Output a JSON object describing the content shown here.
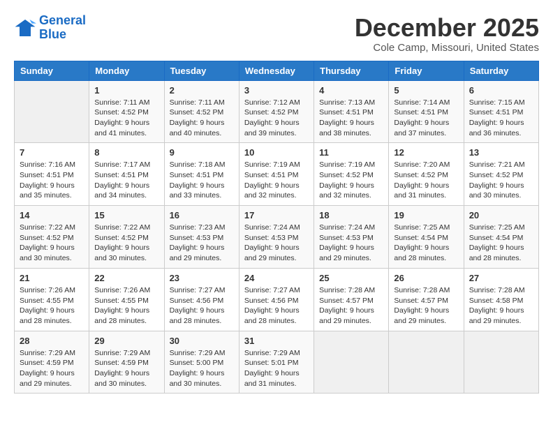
{
  "header": {
    "logo": {
      "line1": "General",
      "line2": "Blue"
    },
    "title": "December 2025",
    "subtitle": "Cole Camp, Missouri, United States"
  },
  "weekdays": [
    "Sunday",
    "Monday",
    "Tuesday",
    "Wednesday",
    "Thursday",
    "Friday",
    "Saturday"
  ],
  "weeks": [
    [
      {
        "day": "",
        "empty": true
      },
      {
        "day": "1",
        "sunrise": "7:11 AM",
        "sunset": "4:52 PM",
        "daylight": "9 hours and 41 minutes."
      },
      {
        "day": "2",
        "sunrise": "7:11 AM",
        "sunset": "4:52 PM",
        "daylight": "9 hours and 40 minutes."
      },
      {
        "day": "3",
        "sunrise": "7:12 AM",
        "sunset": "4:52 PM",
        "daylight": "9 hours and 39 minutes."
      },
      {
        "day": "4",
        "sunrise": "7:13 AM",
        "sunset": "4:51 PM",
        "daylight": "9 hours and 38 minutes."
      },
      {
        "day": "5",
        "sunrise": "7:14 AM",
        "sunset": "4:51 PM",
        "daylight": "9 hours and 37 minutes."
      },
      {
        "day": "6",
        "sunrise": "7:15 AM",
        "sunset": "4:51 PM",
        "daylight": "9 hours and 36 minutes."
      }
    ],
    [
      {
        "day": "7",
        "sunrise": "7:16 AM",
        "sunset": "4:51 PM",
        "daylight": "9 hours and 35 minutes."
      },
      {
        "day": "8",
        "sunrise": "7:17 AM",
        "sunset": "4:51 PM",
        "daylight": "9 hours and 34 minutes."
      },
      {
        "day": "9",
        "sunrise": "7:18 AM",
        "sunset": "4:51 PM",
        "daylight": "9 hours and 33 minutes."
      },
      {
        "day": "10",
        "sunrise": "7:19 AM",
        "sunset": "4:51 PM",
        "daylight": "9 hours and 32 minutes."
      },
      {
        "day": "11",
        "sunrise": "7:19 AM",
        "sunset": "4:52 PM",
        "daylight": "9 hours and 32 minutes."
      },
      {
        "day": "12",
        "sunrise": "7:20 AM",
        "sunset": "4:52 PM",
        "daylight": "9 hours and 31 minutes."
      },
      {
        "day": "13",
        "sunrise": "7:21 AM",
        "sunset": "4:52 PM",
        "daylight": "9 hours and 30 minutes."
      }
    ],
    [
      {
        "day": "14",
        "sunrise": "7:22 AM",
        "sunset": "4:52 PM",
        "daylight": "9 hours and 30 minutes."
      },
      {
        "day": "15",
        "sunrise": "7:22 AM",
        "sunset": "4:52 PM",
        "daylight": "9 hours and 30 minutes."
      },
      {
        "day": "16",
        "sunrise": "7:23 AM",
        "sunset": "4:53 PM",
        "daylight": "9 hours and 29 minutes."
      },
      {
        "day": "17",
        "sunrise": "7:24 AM",
        "sunset": "4:53 PM",
        "daylight": "9 hours and 29 minutes."
      },
      {
        "day": "18",
        "sunrise": "7:24 AM",
        "sunset": "4:53 PM",
        "daylight": "9 hours and 29 minutes."
      },
      {
        "day": "19",
        "sunrise": "7:25 AM",
        "sunset": "4:54 PM",
        "daylight": "9 hours and 28 minutes."
      },
      {
        "day": "20",
        "sunrise": "7:25 AM",
        "sunset": "4:54 PM",
        "daylight": "9 hours and 28 minutes."
      }
    ],
    [
      {
        "day": "21",
        "sunrise": "7:26 AM",
        "sunset": "4:55 PM",
        "daylight": "9 hours and 28 minutes."
      },
      {
        "day": "22",
        "sunrise": "7:26 AM",
        "sunset": "4:55 PM",
        "daylight": "9 hours and 28 minutes."
      },
      {
        "day": "23",
        "sunrise": "7:27 AM",
        "sunset": "4:56 PM",
        "daylight": "9 hours and 28 minutes."
      },
      {
        "day": "24",
        "sunrise": "7:27 AM",
        "sunset": "4:56 PM",
        "daylight": "9 hours and 28 minutes."
      },
      {
        "day": "25",
        "sunrise": "7:28 AM",
        "sunset": "4:57 PM",
        "daylight": "9 hours and 29 minutes."
      },
      {
        "day": "26",
        "sunrise": "7:28 AM",
        "sunset": "4:57 PM",
        "daylight": "9 hours and 29 minutes."
      },
      {
        "day": "27",
        "sunrise": "7:28 AM",
        "sunset": "4:58 PM",
        "daylight": "9 hours and 29 minutes."
      }
    ],
    [
      {
        "day": "28",
        "sunrise": "7:29 AM",
        "sunset": "4:59 PM",
        "daylight": "9 hours and 29 minutes."
      },
      {
        "day": "29",
        "sunrise": "7:29 AM",
        "sunset": "4:59 PM",
        "daylight": "9 hours and 30 minutes."
      },
      {
        "day": "30",
        "sunrise": "7:29 AM",
        "sunset": "5:00 PM",
        "daylight": "9 hours and 30 minutes."
      },
      {
        "day": "31",
        "sunrise": "7:29 AM",
        "sunset": "5:01 PM",
        "daylight": "9 hours and 31 minutes."
      },
      {
        "day": "",
        "empty": true
      },
      {
        "day": "",
        "empty": true
      },
      {
        "day": "",
        "empty": true
      }
    ]
  ]
}
